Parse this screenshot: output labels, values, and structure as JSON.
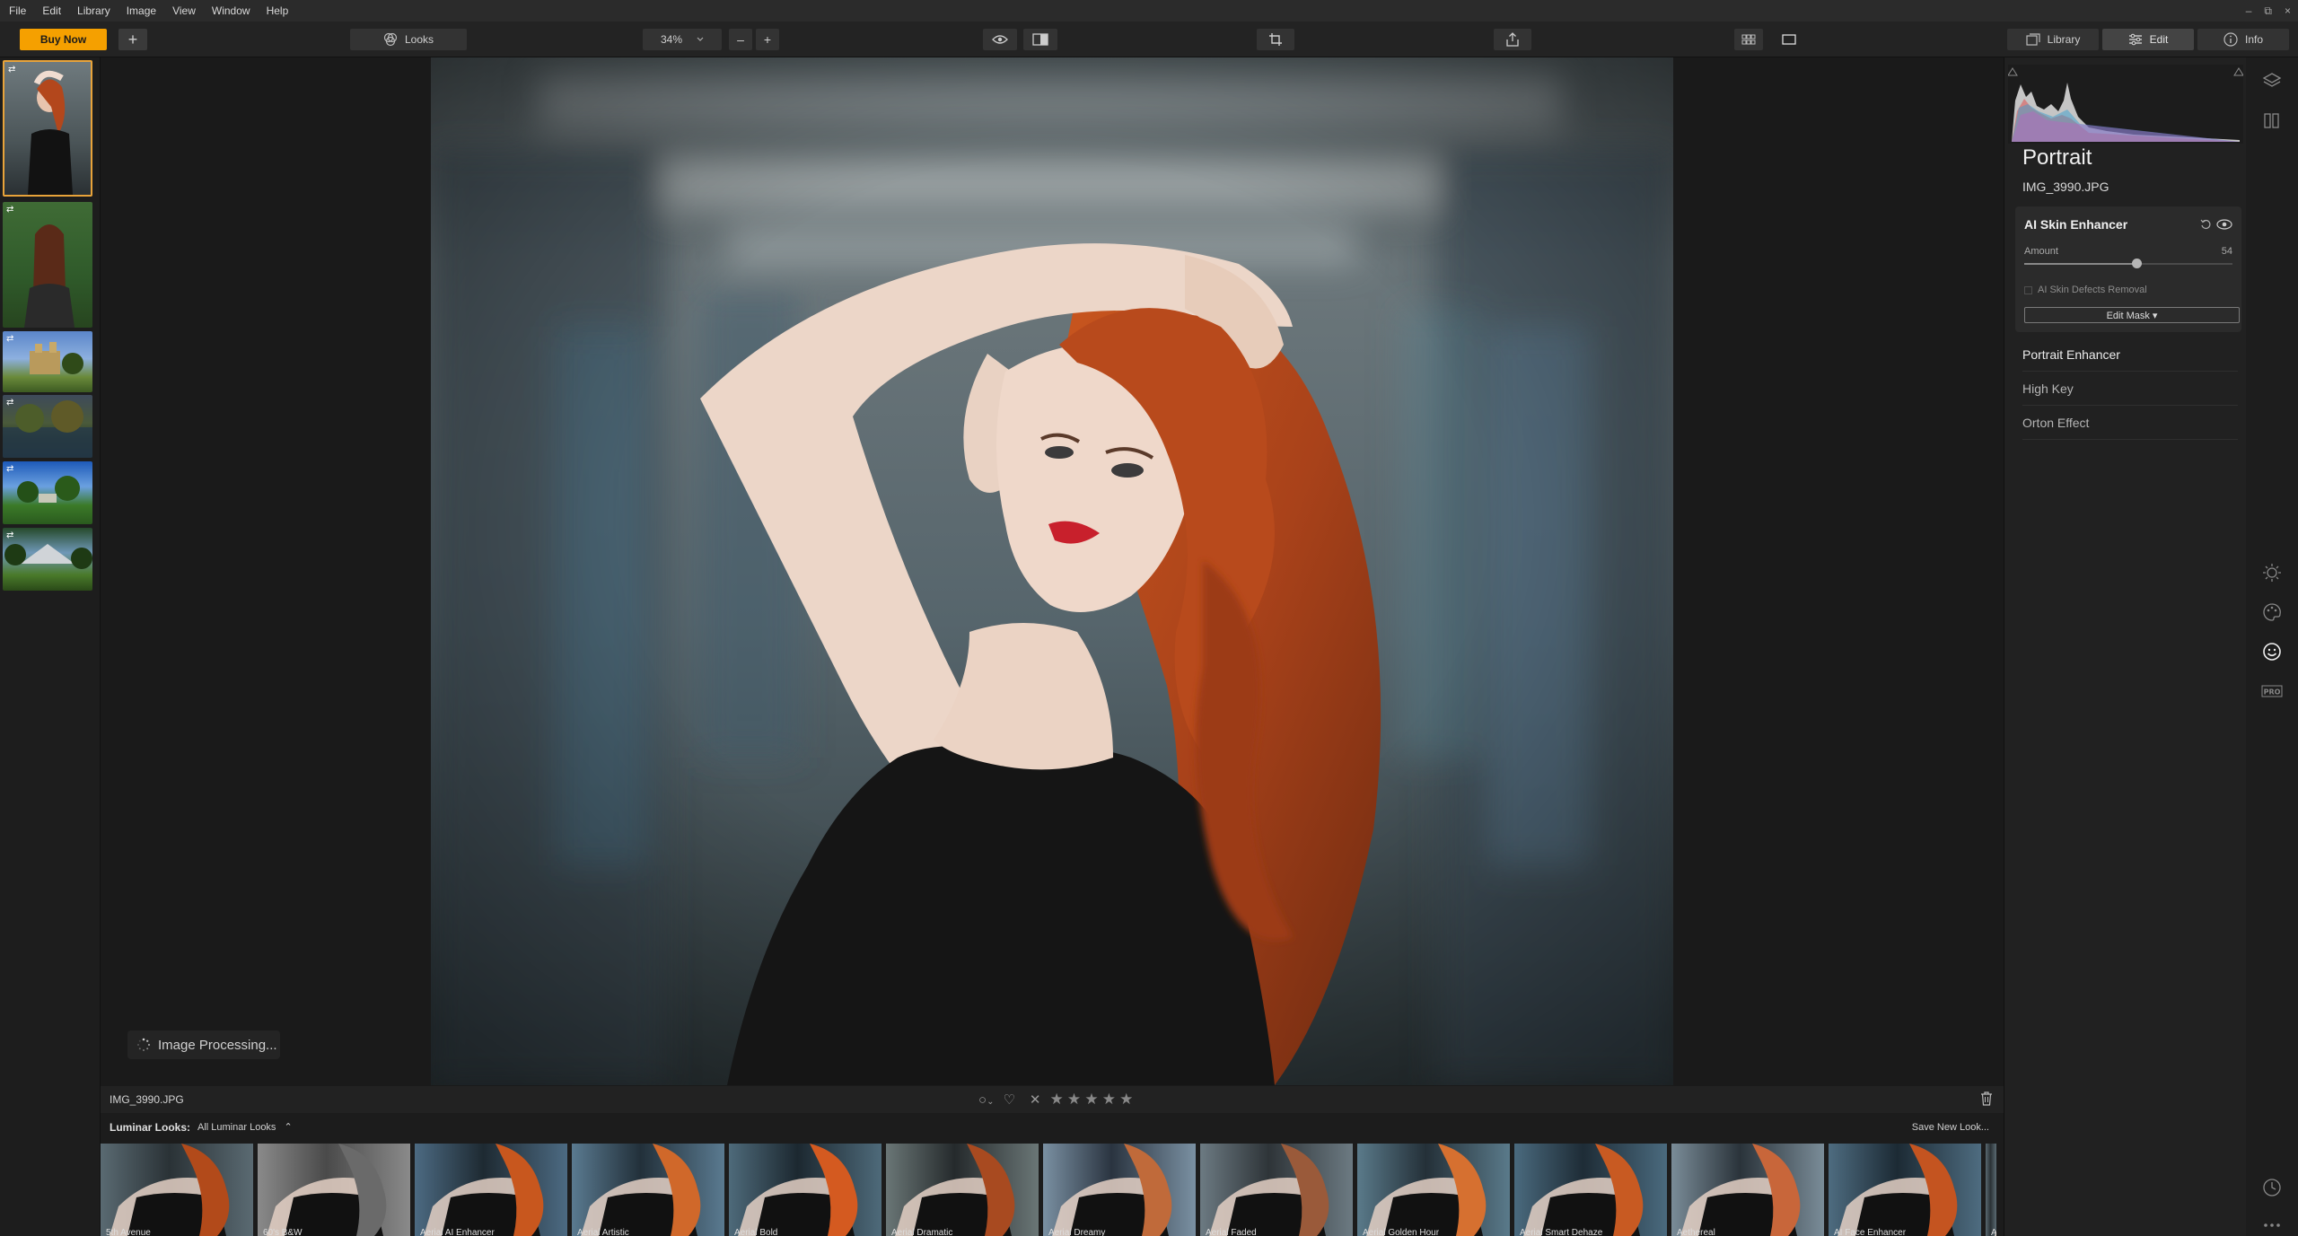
{
  "menu": [
    "File",
    "Edit",
    "Library",
    "Image",
    "View",
    "Window",
    "Help"
  ],
  "window_controls": [
    "–",
    "⧉",
    "×"
  ],
  "toolbar": {
    "buy_now": "Buy Now",
    "add": "+",
    "looks": "Looks",
    "zoom": "34%",
    "zoom_out": "–",
    "zoom_in": "+",
    "tabs": {
      "library": "Library",
      "edit": "Edit",
      "info": "Info"
    }
  },
  "canvas": {
    "processing_text": "Image Processing..."
  },
  "bottom_bar": {
    "filename": "IMG_3990.JPG",
    "flag": "○",
    "flag_caret": "⌄",
    "heart": "♡",
    "reject": "✕",
    "stars": [
      "★",
      "★",
      "★",
      "★",
      "★"
    ]
  },
  "looks_bar": {
    "label": "Luminar Looks:",
    "dropdown": "All Luminar Looks",
    "dropdown_caret": "⌃",
    "save": "Save New Look...",
    "looks": [
      "5th Avenue",
      "60's B&W",
      "Aerial AI Enhancer",
      "Aerial Artistic",
      "Aerial Bold",
      "Aerial Dramatic",
      "Aerial Dreamy",
      "Aerial Faded",
      "Aerial Golden Hour",
      "Aerial Smart Dehaze",
      "Aethereal",
      "AI Face Enhancer",
      "AI"
    ]
  },
  "panel": {
    "title": "Portrait",
    "file": "IMG_3990.JPG",
    "skin_enhancer": {
      "title": "AI Skin Enhancer",
      "amount_label": "Amount",
      "amount": 54,
      "defects_label": "AI Skin Defects Removal",
      "edit_mask": "Edit Mask ▾"
    },
    "filters": [
      "Portrait Enhancer",
      "High Key",
      "Orton Effect"
    ]
  },
  "colors": {
    "accent": "#f5a000",
    "panel_bg": "#212121",
    "selected_border": "#e8a33a"
  }
}
